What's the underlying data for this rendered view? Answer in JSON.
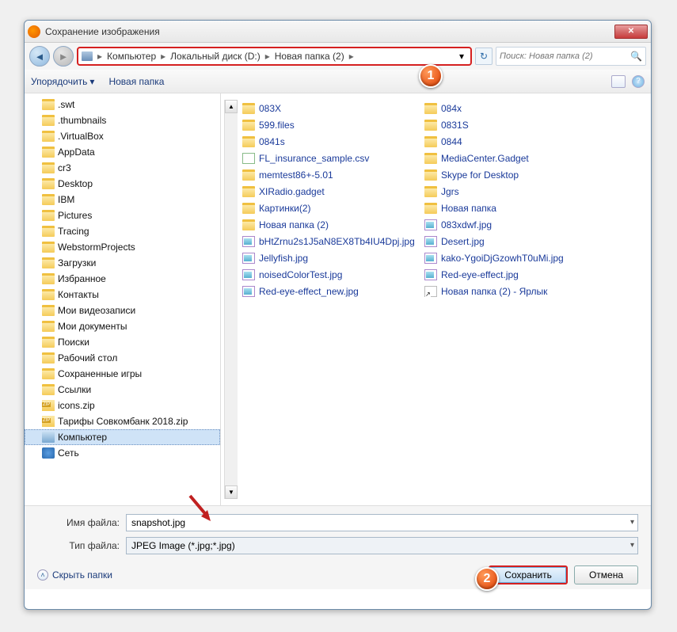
{
  "titlebar": {
    "title": "Сохранение изображения",
    "close_x": "✕"
  },
  "nav": {
    "crumb1": "Компьютер",
    "crumb2": "Локальный диск (D:)",
    "crumb3": "Новая папка (2)",
    "sep": "▸",
    "search_placeholder": "Поиск: Новая папка (2)"
  },
  "toolbar": {
    "organize": "Упорядочить",
    "newfolder": "Новая папка"
  },
  "tree": {
    "items": [
      {
        "label": ".swt",
        "icon": "folder"
      },
      {
        "label": ".thumbnails",
        "icon": "folder"
      },
      {
        "label": ".VirtualBox",
        "icon": "folder"
      },
      {
        "label": "AppData",
        "icon": "folder"
      },
      {
        "label": "cr3",
        "icon": "folder"
      },
      {
        "label": "Desktop",
        "icon": "folder"
      },
      {
        "label": "IBM",
        "icon": "folder"
      },
      {
        "label": "Pictures",
        "icon": "folder"
      },
      {
        "label": "Tracing",
        "icon": "folder"
      },
      {
        "label": "WebstormProjects",
        "icon": "folder"
      },
      {
        "label": "Загрузки",
        "icon": "folder"
      },
      {
        "label": "Избранное",
        "icon": "folder"
      },
      {
        "label": "Контакты",
        "icon": "folder"
      },
      {
        "label": "Мои видеозаписи",
        "icon": "folder"
      },
      {
        "label": "Мои документы",
        "icon": "folder"
      },
      {
        "label": "Поиски",
        "icon": "folder"
      },
      {
        "label": "Рабочий стол",
        "icon": "folder"
      },
      {
        "label": "Сохраненные игры",
        "icon": "folder"
      },
      {
        "label": "Ссылки",
        "icon": "folder"
      },
      {
        "label": "icons.zip",
        "icon": "zip"
      },
      {
        "label": "Тарифы Совкомбанк 2018.zip",
        "icon": "zip"
      },
      {
        "label": "Компьютер",
        "icon": "pc",
        "sel": true
      },
      {
        "label": "Сеть",
        "icon": "net"
      }
    ]
  },
  "files": {
    "col1": [
      {
        "label": "083X",
        "icon": "folder"
      },
      {
        "label": "599.files",
        "icon": "folder"
      },
      {
        "label": "0841s",
        "icon": "folder"
      },
      {
        "label": "FL_insurance_sample.csv",
        "icon": "csv"
      },
      {
        "label": "memtest86+-5.01",
        "icon": "folder"
      },
      {
        "label": "XIRadio.gadget",
        "icon": "folder"
      },
      {
        "label": "Картинки(2)",
        "icon": "folder"
      },
      {
        "label": "Новая папка (2)",
        "icon": "folder"
      },
      {
        "label": "bHtZrnu2s1J5aN8EX8Tb4IU4Dpj.jpg",
        "icon": "img"
      },
      {
        "label": "Jellyfish.jpg",
        "icon": "img"
      },
      {
        "label": "noisedColorTest.jpg",
        "icon": "img"
      },
      {
        "label": "Red-eye-effect_new.jpg",
        "icon": "img"
      }
    ],
    "col2": [
      {
        "label": "084x",
        "icon": "folder"
      },
      {
        "label": "0831S",
        "icon": "folder"
      },
      {
        "label": "0844",
        "icon": "folder"
      },
      {
        "label": "MediaCenter.Gadget",
        "icon": "folder"
      },
      {
        "label": "Skype for Desktop",
        "icon": "folder"
      },
      {
        "label": "Jgrs",
        "icon": "folder"
      },
      {
        "label": "Новая папка",
        "icon": "folder"
      },
      {
        "label": "083xdwf.jpg",
        "icon": "img"
      },
      {
        "label": "Desert.jpg",
        "icon": "img"
      },
      {
        "label": "kako-YgoiDjGzowhT0uMi.jpg",
        "icon": "img"
      },
      {
        "label": "Red-eye-effect.jpg",
        "icon": "img"
      },
      {
        "label": "Новая папка (2) - Ярлык",
        "icon": "shortcut"
      }
    ]
  },
  "bottom": {
    "filename_label": "Имя файла:",
    "filename_value": "snapshot.jpg",
    "filetype_label": "Тип файла:",
    "filetype_value": "JPEG Image (*.jpg;*.jpg)",
    "hide_folders": "Скрыть папки",
    "save": "Сохранить",
    "cancel": "Отмена"
  },
  "anno": {
    "one": "1",
    "two": "2"
  }
}
